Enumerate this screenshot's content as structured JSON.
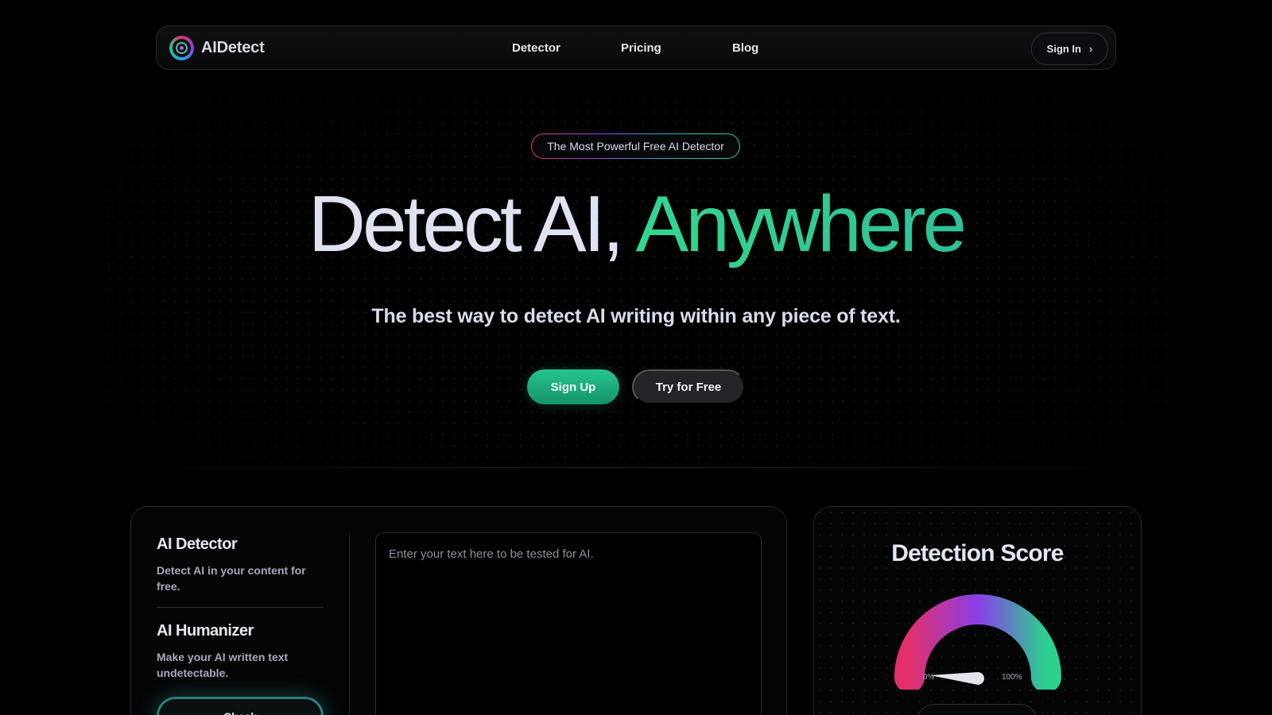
{
  "brand": {
    "name": "AIDetect",
    "logo_icon": "target-icon"
  },
  "nav": {
    "links": [
      "Detector",
      "Pricing",
      "Blog"
    ],
    "signin_label": "Sign In",
    "signin_icon": "chevron-right-icon"
  },
  "hero": {
    "badge": "The Most Powerful Free AI Detector",
    "headline_main": "Detect AI,",
    "headline_accent": "Anywhere",
    "subheadline": "The best way to detect AI writing within any piece of text.",
    "primary_cta": "Sign Up",
    "secondary_cta": "Try for Free"
  },
  "tools": {
    "items": [
      {
        "title": "AI Detector",
        "description": "Detect AI in your content for free."
      },
      {
        "title": "AI Humanizer",
        "description": "Make your AI written text undetectable."
      }
    ],
    "cta_label": "Check"
  },
  "editor": {
    "placeholder": "Enter your text here to be tested for AI."
  },
  "score": {
    "title": "Detection Score",
    "min_label": "0%",
    "max_label": "100%",
    "value": 0,
    "colors": {
      "start": "#e3306b",
      "mid": "#8a3ee8",
      "end": "#2bd18f"
    }
  },
  "colors": {
    "accent": "#26c48f",
    "background": "#000000"
  }
}
